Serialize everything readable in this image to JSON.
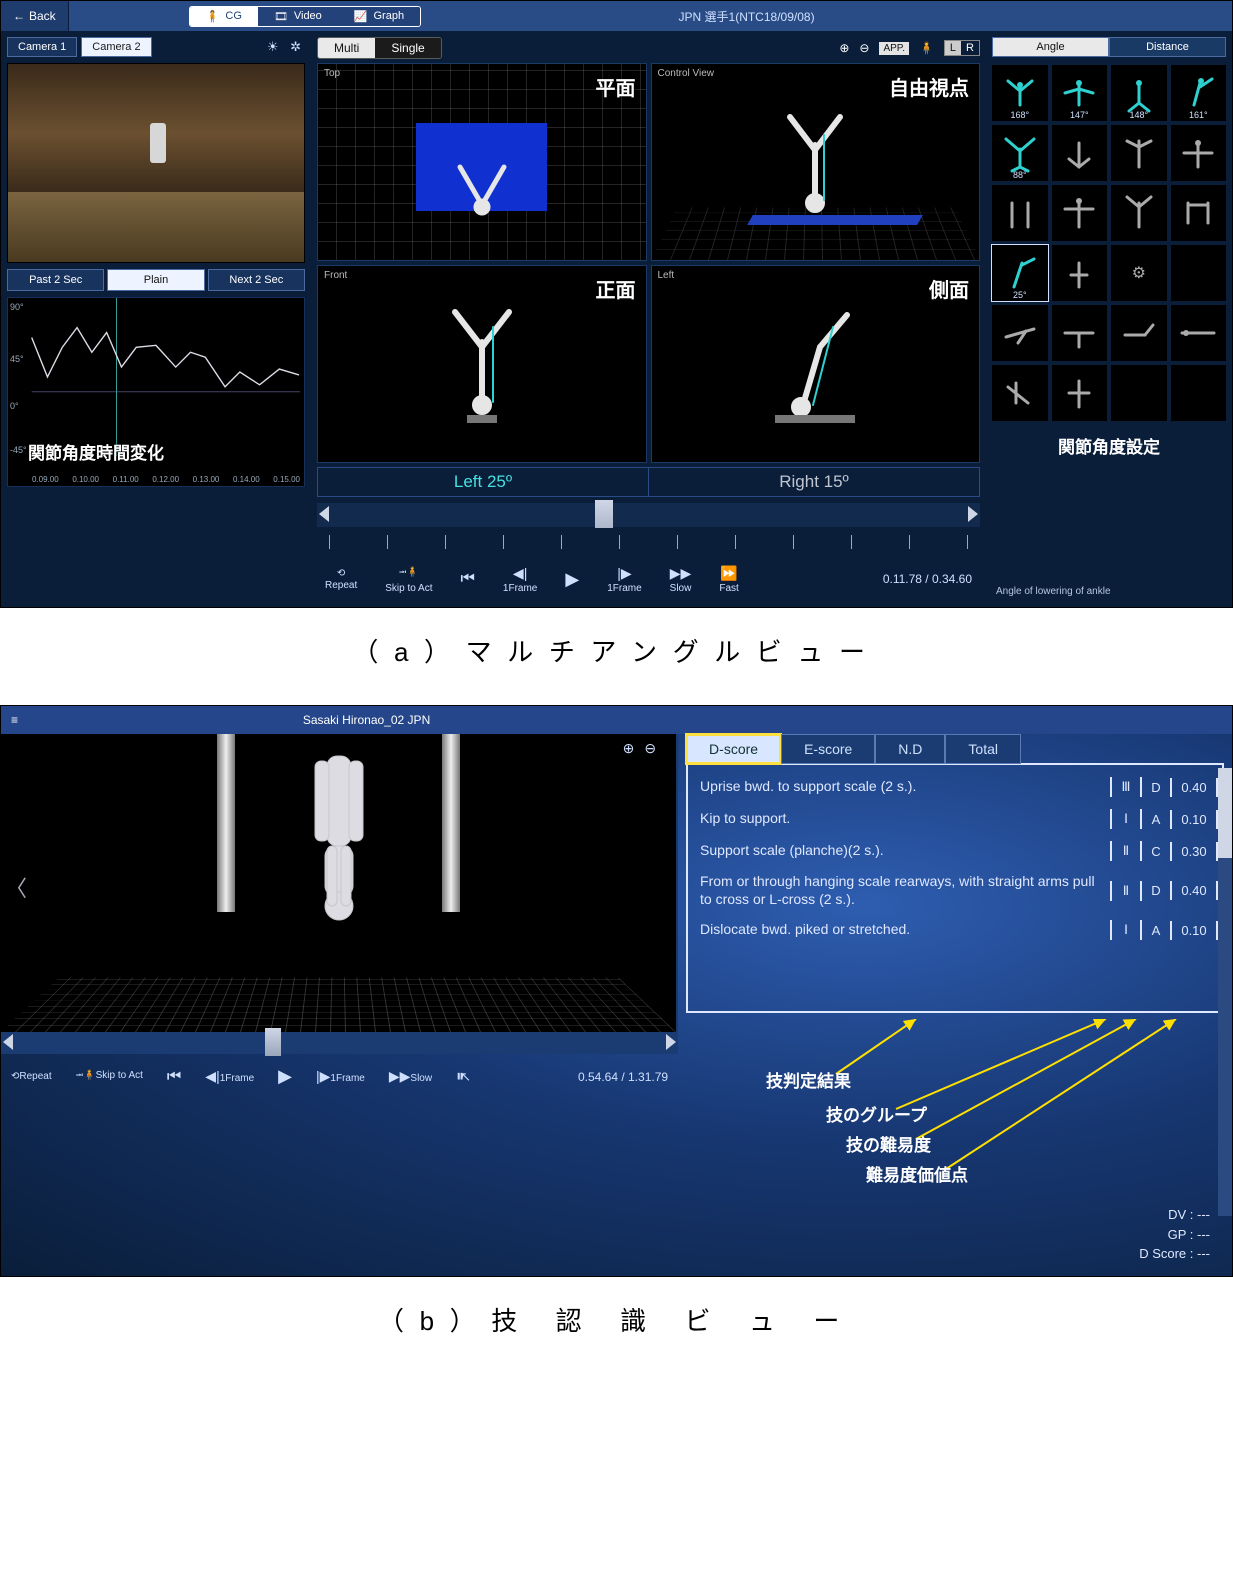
{
  "captions": {
    "a": "（a）マルチアングルビュー",
    "b": "（b）技 認 識 ビ ュ ー"
  },
  "topbar": {
    "back": "Back",
    "modes": [
      "CG",
      "Video",
      "Graph"
    ],
    "title": "JPN 選手1(NTC18/09/08)"
  },
  "cameras": {
    "tabs": [
      "Camera 1",
      "Camera 2"
    ]
  },
  "past": {
    "buttons": [
      "Past 2 Sec",
      "Plain",
      "Next 2 Sec"
    ]
  },
  "graph": {
    "yticks": [
      "90°",
      "45°",
      "0°",
      "-45°"
    ],
    "xticks": [
      "0.09.00",
      "0.10.00",
      "0.11.00",
      "0.12.00",
      "0.13.00",
      "0.14.00",
      "0.15.00"
    ],
    "label": "関節角度時間変化"
  },
  "ms": {
    "seg": [
      "Multi",
      "Single"
    ],
    "app": "APP.",
    "lr": [
      "L",
      "R"
    ]
  },
  "panes": {
    "top": {
      "lbl": "Top",
      "jp": "平面"
    },
    "cv": {
      "lbl": "Control View",
      "jp": "自由視点"
    },
    "front": {
      "lbl": "Front",
      "jp": "正面"
    },
    "left": {
      "lbl": "Left",
      "jp": "側面"
    }
  },
  "angles": {
    "left": "Left 25º",
    "right": "Right 15º"
  },
  "pctrls": {
    "repeat": "Repeat",
    "skip": "Skip to Act",
    "frameL": "1Frame",
    "frameR": "1Frame",
    "slow": "Slow",
    "fast": "Fast",
    "time": "0.11.78 / 0.34.60"
  },
  "right": {
    "tabs": [
      "Angle",
      "Distance"
    ],
    "degs": [
      "168°",
      "147°",
      "148°",
      "161°",
      "88°",
      "",
      "",
      "",
      "",
      "",
      "",
      "",
      "25°",
      "",
      "",
      "",
      "",
      "",
      "",
      "",
      "",
      "",
      "",
      ""
    ],
    "title": "関節角度設定",
    "sub": "Angle of lowering of ankle"
  },
  "app2": {
    "title": "Sasaki Hironao_02 JPN",
    "tabs": [
      "D-score",
      "E-score",
      "N.D",
      "Total"
    ],
    "skills": [
      {
        "name": "Uprise bwd. to support scale (2 s.).",
        "grp": "Ⅲ",
        "dif": "D",
        "val": "0.40"
      },
      {
        "name": "Kip to support.",
        "grp": "Ⅰ",
        "dif": "A",
        "val": "0.10"
      },
      {
        "name": "Support scale (planche)(2 s.).",
        "grp": "Ⅱ",
        "dif": "C",
        "val": "0.30"
      },
      {
        "name": "From or through hanging scale rearways, with straight arms pull to cross or L-cross (2 s.).",
        "grp": "Ⅱ",
        "dif": "D",
        "val": "0.40"
      },
      {
        "name": "Dislocate bwd. piked or stretched.",
        "grp": "Ⅰ",
        "dif": "A",
        "val": "0.10"
      }
    ],
    "annots": [
      "技判定結果",
      "技のグループ",
      "技の難易度",
      "難易度価値点"
    ],
    "totals": [
      "DV : ---",
      "GP : ---",
      "D Score : ---"
    ],
    "pctrls": {
      "repeat": "Repeat",
      "skip": "Skip to Act",
      "frameL": "1Frame",
      "frameR": "1Frame",
      "slow": "Slow",
      "time": "0.54.64 / 1.31.79"
    }
  }
}
